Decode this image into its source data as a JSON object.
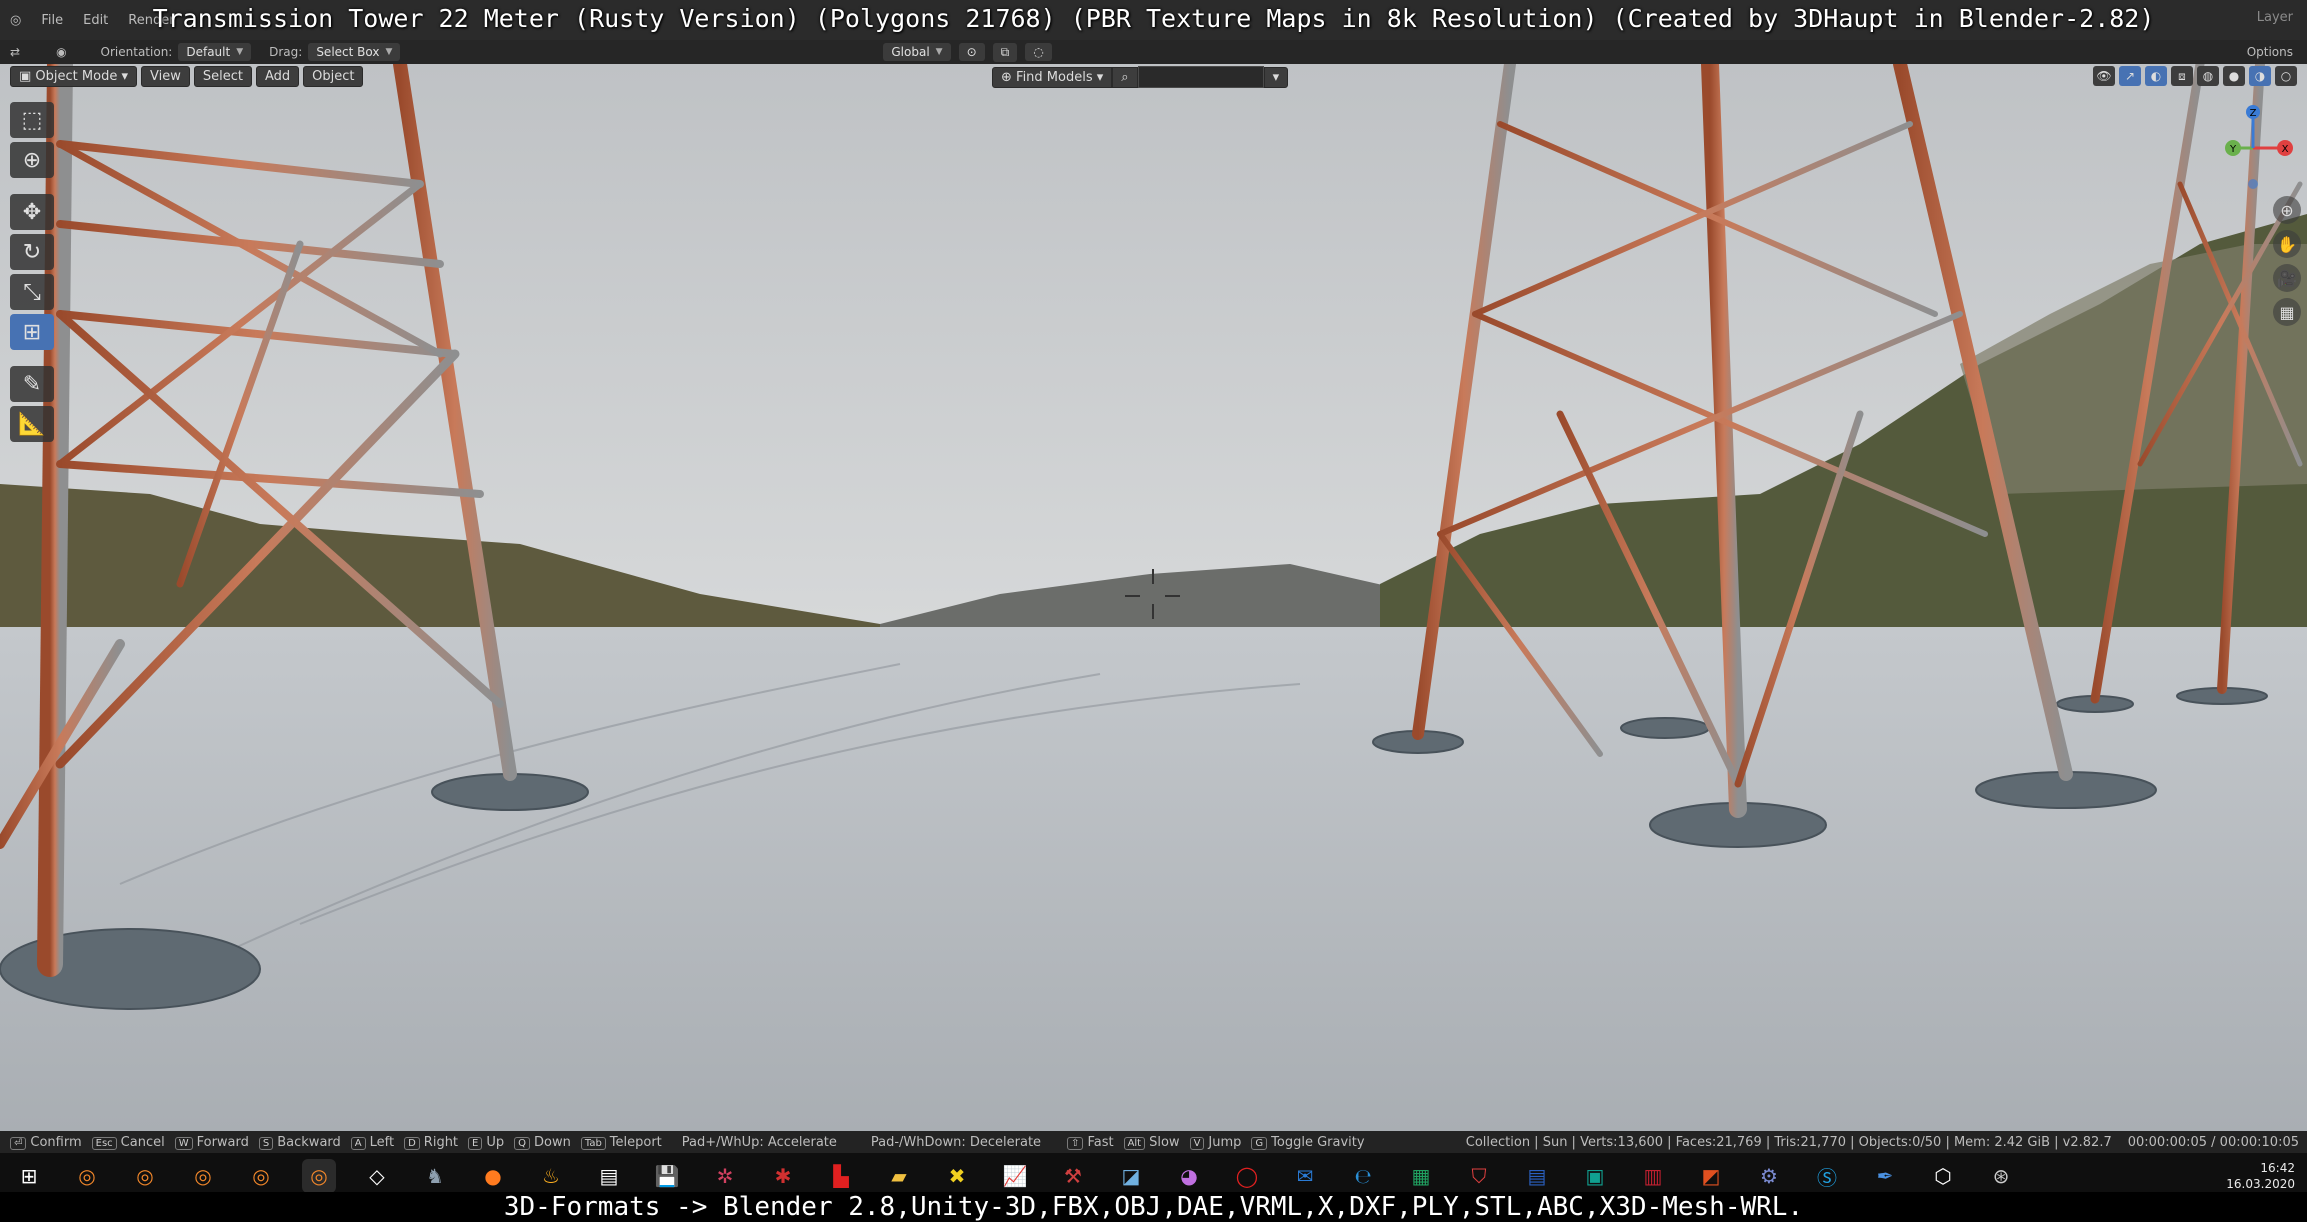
{
  "title_overlay": "Transmission Tower 22 Meter (Rusty Version) (Polygons 21768) (PBR Texture Maps in 8k Resolution) (Created by 3DHaupt in Blender-2.82)",
  "menu": {
    "file": "File",
    "edit": "Edit",
    "render": "Render",
    "right_label": "Layer"
  },
  "tool_header": {
    "orientation_label": "Orientation:",
    "orientation_value": "Default",
    "drag_label": "Drag:",
    "drag_value": "Select Box",
    "transform_orientation": "Global",
    "options": "Options"
  },
  "viewport_header": {
    "mode": "Object Mode",
    "view": "View",
    "select": "Select",
    "add": "Add",
    "object": "Object",
    "find_models": "Find Models"
  },
  "gizmo": {
    "x": "X",
    "y": "Y",
    "z": "Z"
  },
  "statusbar": {
    "items": [
      {
        "key": "⏎",
        "label": "Confirm"
      },
      {
        "key": "Esc",
        "label": "Cancel"
      },
      {
        "key": "W",
        "label": "Forward"
      },
      {
        "key": "S",
        "label": "Backward"
      },
      {
        "key": "A",
        "label": "Left"
      },
      {
        "key": "D",
        "label": "Right"
      },
      {
        "key": "E",
        "label": "Up"
      },
      {
        "key": "Q",
        "label": "Down"
      },
      {
        "key": "Tab",
        "label": "Teleport"
      },
      {
        "key": "",
        "label": "Pad+/WhUp: Accelerate"
      },
      {
        "key": "",
        "label": "Pad-/WhDown: Decelerate"
      },
      {
        "key": "⇧",
        "label": "Fast"
      },
      {
        "key": "Alt",
        "label": "Slow"
      },
      {
        "key": "V",
        "label": "Jump"
      },
      {
        "key": "G",
        "label": "Toggle Gravity"
      }
    ],
    "stats": "Collection | Sun | Verts:13,600 | Faces:21,769 | Tris:21,770 | Objects:0/50 | Mem: 2.42 GiB | v2.82.7",
    "timer": "00:00:00:05 / 00:00:10:05"
  },
  "taskbar": {
    "time": "16:42",
    "date": "16.03.2020"
  },
  "caption": "3D-Formats -> Blender 2.8,Unity-3D,FBX,OBJ,DAE,VRML,X,DXF,PLY,STL,ABC,X3D-Mesh-WRL.",
  "colors": {
    "accent": "#4772b3",
    "rust": "#b4502c",
    "steel": "#a7a9ab",
    "ground": "#b9bec3",
    "sky": "#c9ccce"
  }
}
